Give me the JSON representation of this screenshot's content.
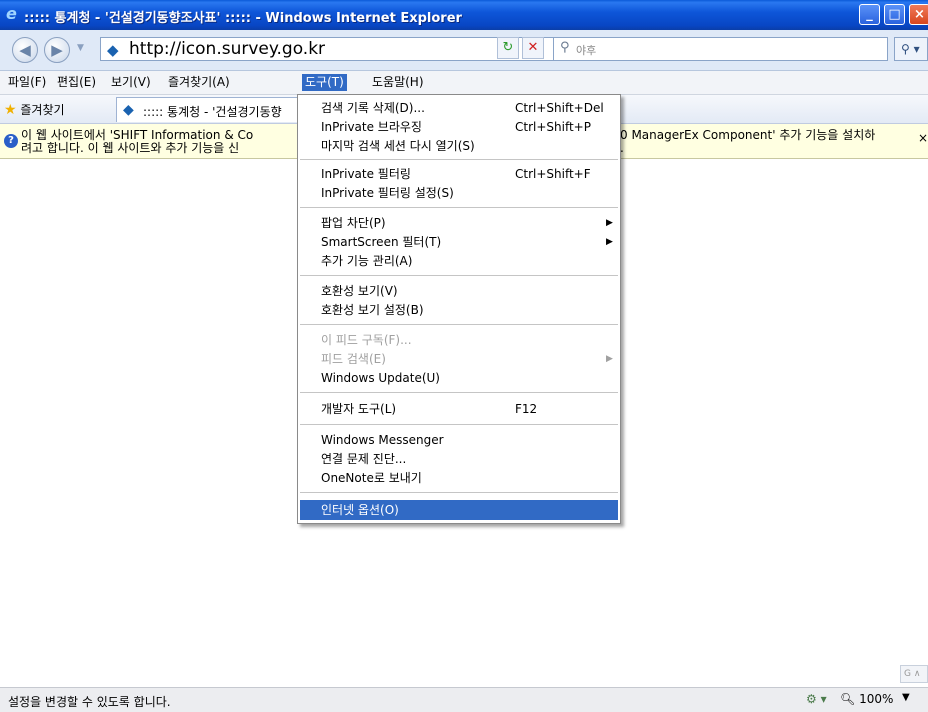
{
  "window": {
    "title": "::::: 통계청 - '건설경기동향조사표' ::::: - Windows Internet Explorer"
  },
  "address": {
    "url": "http://icon.survey.go.kr",
    "search_placeholder": "야후"
  },
  "menubar": {
    "items": [
      "파일(F)",
      "편집(E)",
      "보기(V)",
      "즐겨찾기(A)",
      "도구(T)",
      "도움말(H)"
    ]
  },
  "tabbar": {
    "favorites_label": "즐겨찾기",
    "tab_title": "::::: 통계청 - '건설경기동향"
  },
  "infobar": {
    "line1_left": "이 웹 사이트에서 'SHIFT Information & Co",
    "line2_left": "려고 합니다. 이 웹 사이트와 추가 기능을 신",
    "line1_right": "0 ManagerEx Component' 추가 기능을 설치하",
    "line2_right": ".",
    "close_label": "×"
  },
  "tools_menu": {
    "items": [
      {
        "label": "검색 기록 삭제(D)...",
        "shortcut": "Ctrl+Shift+Del"
      },
      {
        "label": "InPrivate 브라우징",
        "shortcut": "Ctrl+Shift+P"
      },
      {
        "label": "마지막 검색 세션 다시 열기(S)",
        "shortcut": ""
      },
      {
        "label": "InPrivate 필터링",
        "shortcut": "Ctrl+Shift+F"
      },
      {
        "label": "InPrivate 필터링 설정(S)",
        "shortcut": ""
      },
      {
        "label": "팝업 차단(P)",
        "shortcut": ""
      },
      {
        "label": "SmartScreen 필터(T)",
        "shortcut": ""
      },
      {
        "label": "추가 기능 관리(A)",
        "shortcut": ""
      },
      {
        "label": "호환성 보기(V)",
        "shortcut": ""
      },
      {
        "label": "호환성 보기 설정(B)",
        "shortcut": ""
      },
      {
        "label": "이 피드 구독(F)...",
        "shortcut": ""
      },
      {
        "label": "피드 검색(E)",
        "shortcut": ""
      },
      {
        "label": "Windows Update(U)",
        "shortcut": ""
      },
      {
        "label": "개발자 도구(L)",
        "shortcut": "F12"
      },
      {
        "label": "Windows Messenger",
        "shortcut": ""
      },
      {
        "label": "연결 문제 진단...",
        "shortcut": ""
      },
      {
        "label": "OneNote로 보내기",
        "shortcut": ""
      },
      {
        "label": "인터넷 옵션(O)",
        "shortcut": ""
      }
    ]
  },
  "statusbar": {
    "text": "설정을 변경할 수 있도록 합니다.",
    "zoom": "100%"
  },
  "colors": {
    "titlebar": "#0e56d9",
    "highlight": "#316ac5",
    "infobar_bg": "#ffffe1"
  }
}
